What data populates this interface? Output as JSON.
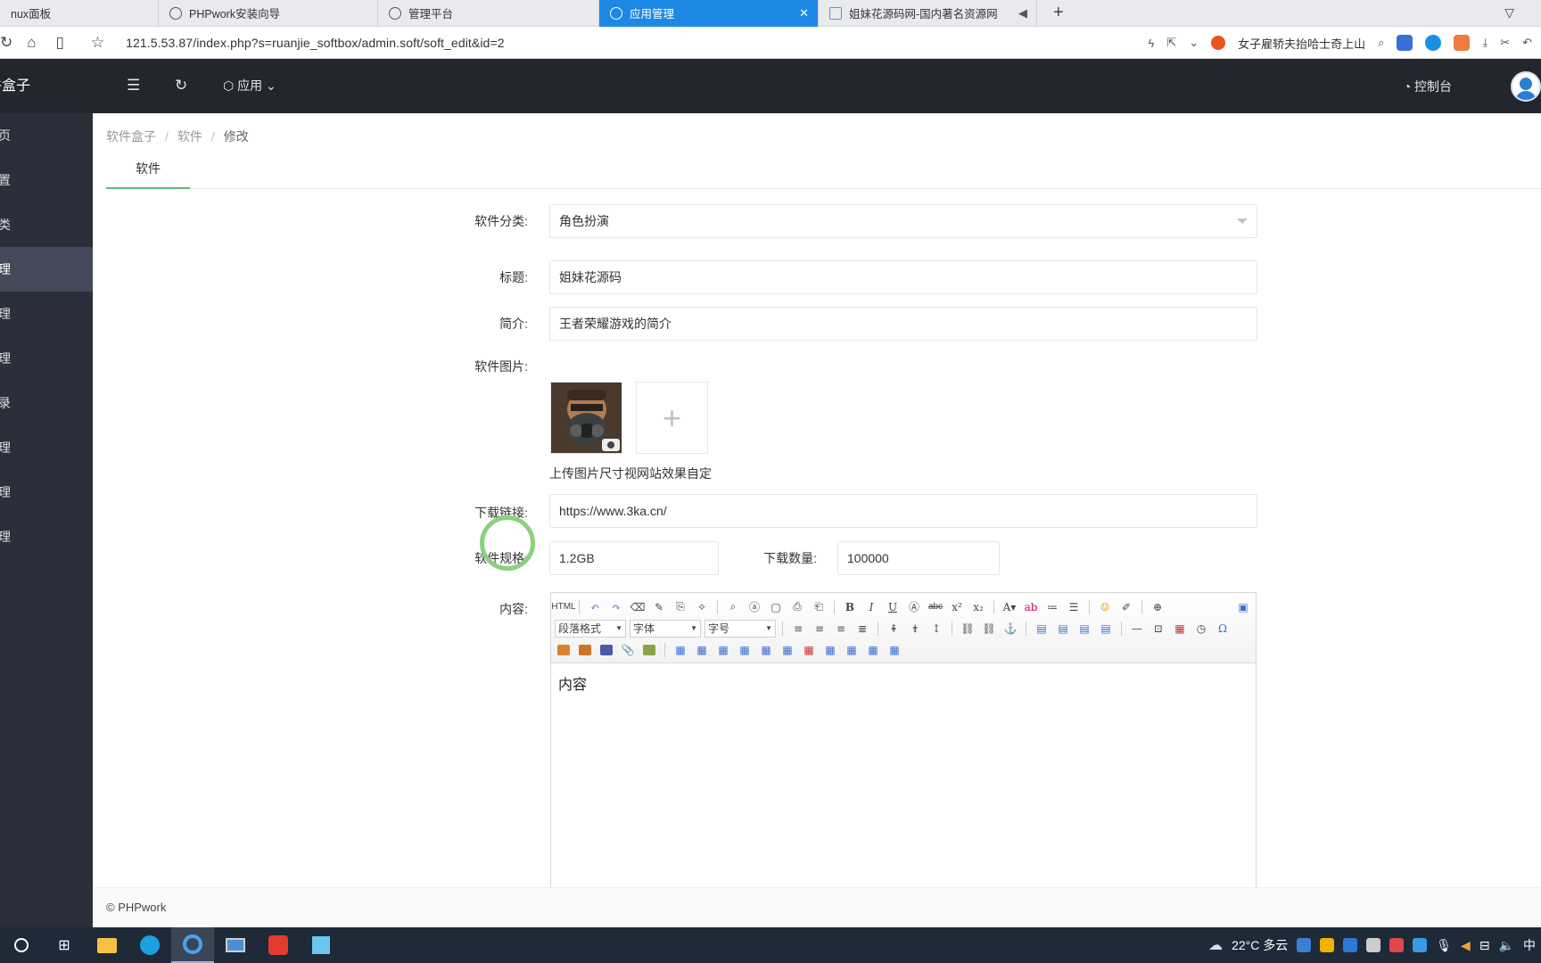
{
  "browser": {
    "tabs": [
      {
        "label": "nux面板"
      },
      {
        "label": "PHPwork安装向导"
      },
      {
        "label": "管理平台"
      },
      {
        "label": "应用管理",
        "active": true
      },
      {
        "label": "姐妹花源码网-国内著名资源网"
      }
    ],
    "close_glyph": "✕",
    "new_tab_glyph": "+",
    "url": "121.5.53.87/index.php?s=ruanjie_softbox/admin.soft/soft_edit&id=2",
    "search_text": "女子雇轿夫抬哈士奇上山"
  },
  "header": {
    "logo": "件盒子",
    "app_menu": "应用",
    "console": "控制台"
  },
  "sidebar": {
    "items": [
      {
        "label": "页"
      },
      {
        "label": "置"
      },
      {
        "label": "类"
      },
      {
        "label": "理",
        "active": true
      },
      {
        "label": "理"
      },
      {
        "label": "理"
      },
      {
        "label": "录"
      },
      {
        "label": "理"
      },
      {
        "label": "理"
      },
      {
        "label": "理"
      }
    ]
  },
  "breadcrumb": [
    "软件盒子",
    "软件",
    "修改"
  ],
  "breadcrumb_sep": "/",
  "tab_soft": "软件",
  "form": {
    "category_label": "软件分类:",
    "category_value": "角色扮演",
    "title_label": "标题:",
    "title_value": "姐妹花源码",
    "intro_label": "简介:",
    "intro_value": "王者荣耀游戏的简介",
    "image_label": "软件图片:",
    "upload_glyph": "+",
    "image_hint": "上传图片尺寸视网站效果自定",
    "download_label": "下载链接:",
    "download_value": "https://www.3ka.cn/",
    "size_label": "软件规格:",
    "size_value": "1.2GB",
    "count_label": "下载数量:",
    "count_value": "100000",
    "content_label": "内容:"
  },
  "editor": {
    "format_select": "段落格式",
    "font_select": "字体",
    "fontsize_select": "字号",
    "body": "内容"
  },
  "footer": "© PHPwork",
  "taskbar": {
    "weather": "22°C  多云",
    "ime": "中"
  },
  "colors": {
    "accent_green": "#5fb878",
    "active_tab_blue": "#1e88e5",
    "header_dark": "#23262e",
    "sidebar_dark": "#2b2f3a"
  }
}
